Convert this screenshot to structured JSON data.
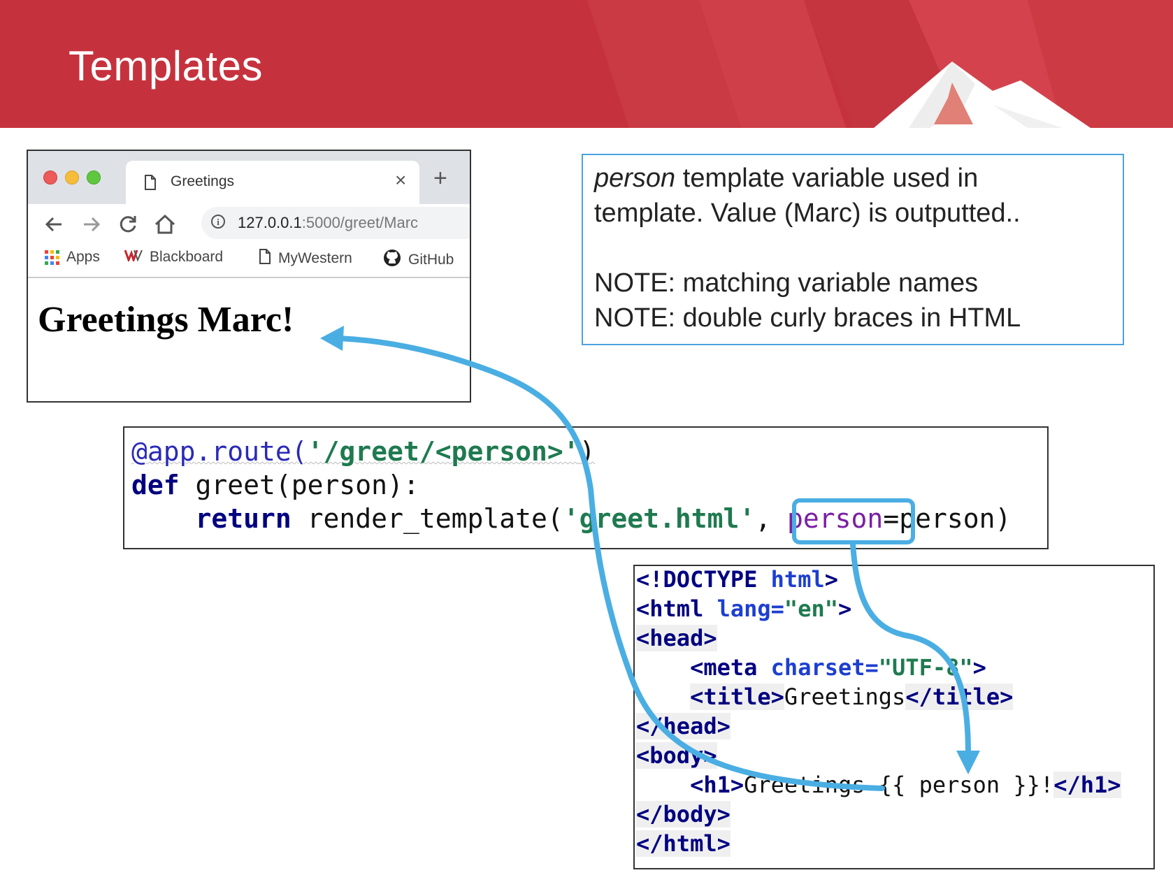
{
  "slide": {
    "title": "Templates"
  },
  "browser": {
    "tab_label": "Greetings",
    "tab_close": "×",
    "new_tab": "+",
    "url_host": "127.0.0.1",
    "url_path": ":5000/greet/Marc",
    "bookmarks": [
      "Apps",
      "Blackboard",
      "MyWestern",
      "GitHub"
    ],
    "page_heading": "Greetings Marc!"
  },
  "note": {
    "line1_italic": "person",
    "line1_rest": " template variable used in",
    "line2": "template.  Value (Marc) is outputted..",
    "line3": "NOTE: matching variable names",
    "line4": "NOTE: double curly braces in HTML"
  },
  "python_code": {
    "line1": {
      "decorator": "@app.route(",
      "string": "'/greet/<person>'",
      "close": ")"
    },
    "line2": {
      "keyword": "def",
      "rest": " greet(person):"
    },
    "line3": {
      "indent": "    ",
      "keyword": "return",
      "call": " render_template(",
      "string": "'greet.html'",
      "comma": ", ",
      "arg": "person",
      "eq": "=",
      "value": "person)"
    }
  },
  "html_code": {
    "l1": {
      "open": "<!DOCTYPE ",
      "attr": "html",
      "close": ">"
    },
    "l2": {
      "tag": "<html ",
      "attr": "lang=",
      "val": "\"en\"",
      "close": ">"
    },
    "l3": "<head>",
    "l4": {
      "indent": "    ",
      "tag": "<meta ",
      "attr": "charset=",
      "val": "\"UTF-8\"",
      "close": ">"
    },
    "l5": {
      "indent": "    ",
      "open": "<title>",
      "text": "Greetings",
      "close": "</title>"
    },
    "l6": "</head>",
    "l7": "<body>",
    "l8": {
      "indent": "    ",
      "open": "<h1>",
      "text": "Greetings {{ person }}!",
      "close": "</h1>"
    },
    "l9": "</body>",
    "l10": "</html>"
  },
  "colors": {
    "banner": "#c5323d",
    "arrow": "#4aaee3",
    "note_border": "#4aa3df"
  },
  "icons": [
    "page-icon",
    "back-arrow-icon",
    "forward-arrow-icon",
    "reload-icon",
    "home-icon",
    "info-icon",
    "apps-grid-icon",
    "blackboard-icon",
    "github-icon"
  ]
}
